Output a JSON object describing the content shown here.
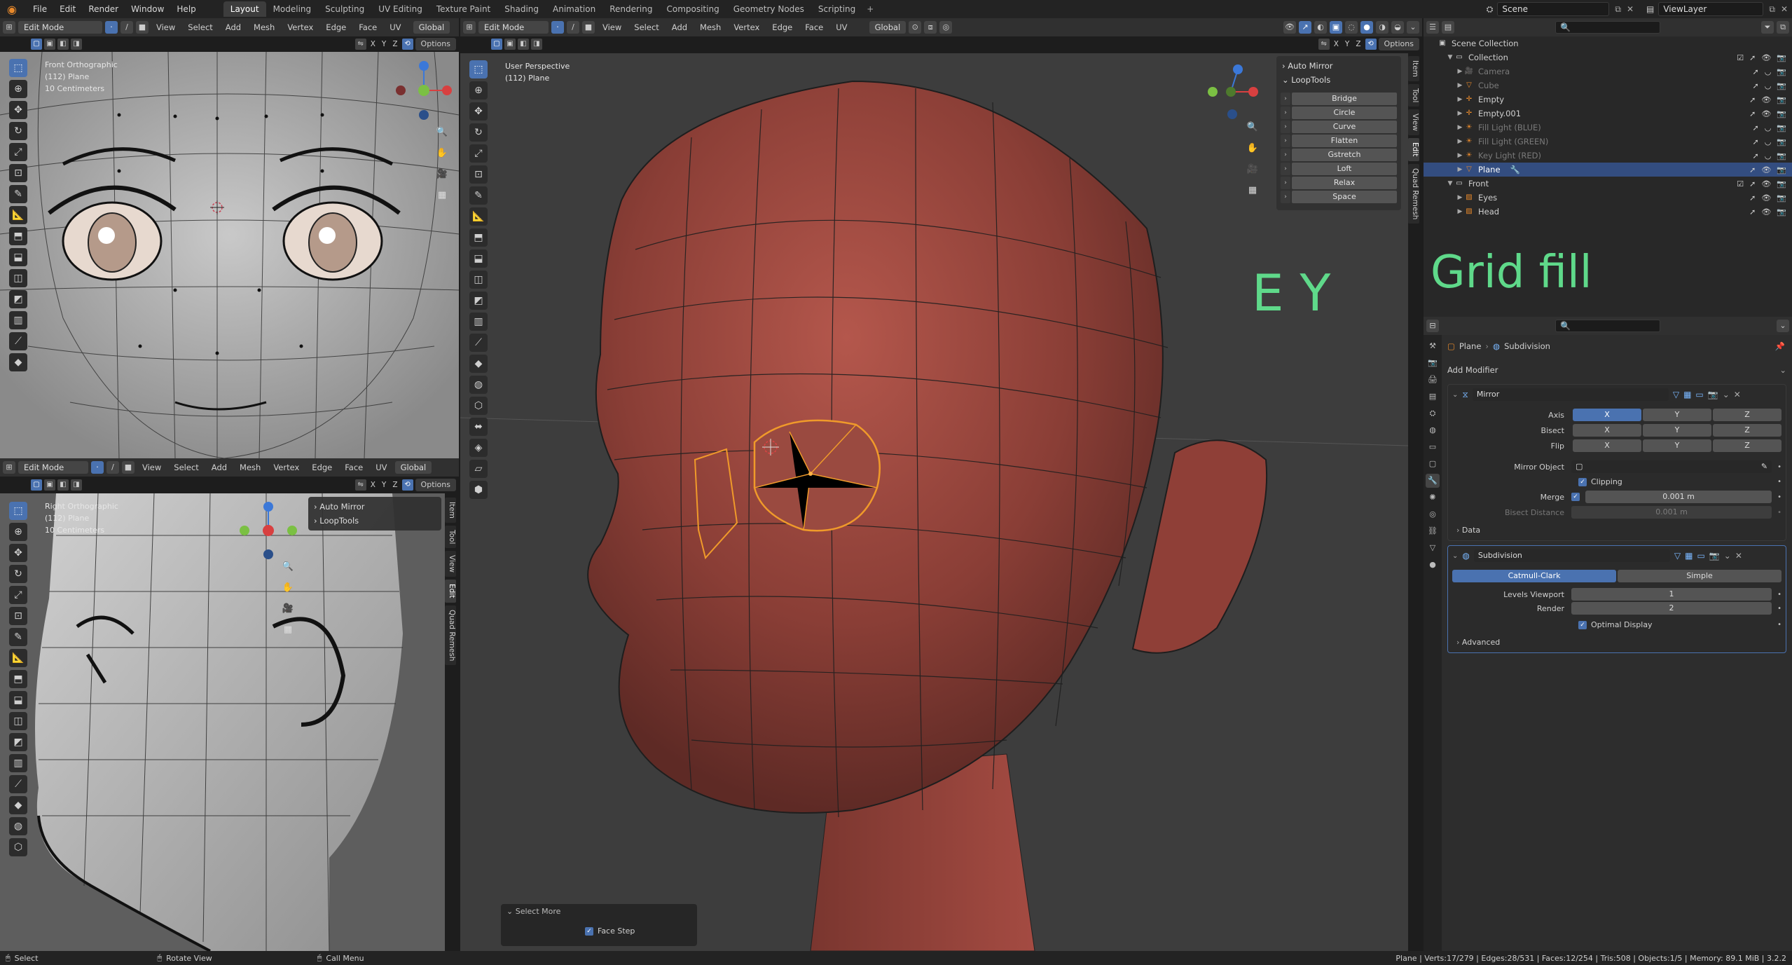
{
  "topbar": {
    "menus": [
      "File",
      "Edit",
      "Render",
      "Window",
      "Help"
    ],
    "workspaces": [
      "Layout",
      "Modeling",
      "Sculpting",
      "UV Editing",
      "Texture Paint",
      "Shading",
      "Animation",
      "Rendering",
      "Compositing",
      "Geometry Nodes",
      "Scripting"
    ],
    "active_workspace": "Layout",
    "scene": "Scene",
    "view_layer": "ViewLayer"
  },
  "viewport_header": {
    "mode": "Edit Mode",
    "menus": [
      "View",
      "Select",
      "Add",
      "Mesh",
      "Vertex",
      "Edge",
      "Face",
      "UV"
    ],
    "transform": "Global",
    "options": "Options",
    "axis_x": "X",
    "axis_y": "Y",
    "axis_z": "Z"
  },
  "front_view": {
    "line1": "Front Orthographic",
    "line2": "(112) Plane",
    "line3": "10 Centimeters"
  },
  "right_view": {
    "line1": "Right Orthographic",
    "line2": "(112) Plane",
    "line3": "10 Centimeters",
    "panel_auto_mirror": "Auto Mirror",
    "panel_looptools": "LoopTools"
  },
  "persp_view": {
    "line1": "User Perspective",
    "line2": "(112) Plane",
    "panel_auto_mirror": "Auto Mirror",
    "panel_looptools": "LoopTools",
    "looptools": [
      "Bridge",
      "Circle",
      "Curve",
      "Flatten",
      "Gstretch",
      "Loft",
      "Relax",
      "Space"
    ],
    "select_more_title": "Select More",
    "face_step": "Face Step",
    "annotation": "E Y"
  },
  "side_tabs": [
    "Item",
    "Tool",
    "View",
    "Edit",
    "Quad Remesh"
  ],
  "outliner": {
    "scene_collection": "Scene Collection",
    "collection": "Collection",
    "items": [
      "Camera",
      "Cube",
      "Empty",
      "Empty.001",
      "Fill Light (BLUE)",
      "Fill Light (GREEN)",
      "Key Light (RED)",
      "Plane"
    ],
    "front": "Front",
    "front_items": [
      "Eyes",
      "Head"
    ],
    "annotation": "Grid fill"
  },
  "properties": {
    "breadcrumb_object": "Plane",
    "breadcrumb_modifier": "Subdivision",
    "add_modifier": "Add Modifier",
    "mirror": {
      "name": "Mirror",
      "axis_label": "Axis",
      "bisect_label": "Bisect",
      "flip_label": "Flip",
      "x": "X",
      "y": "Y",
      "z": "Z",
      "mirror_object_label": "Mirror Object",
      "clipping": "Clipping",
      "merge_label": "Merge",
      "merge_value": "0.001 m",
      "bisect_distance_label": "Bisect Distance",
      "bisect_distance_value": "0.001 m",
      "data": "Data"
    },
    "subdivision": {
      "name": "Subdivision",
      "catmull": "Catmull-Clark",
      "simple": "Simple",
      "levels_viewport_label": "Levels Viewport",
      "levels_viewport": "1",
      "render_label": "Render",
      "render": "2",
      "optimal_display": "Optimal Display",
      "advanced": "Advanced"
    }
  },
  "statusbar": {
    "select": "Select",
    "rotate": "Rotate View",
    "call_menu": "Call Menu",
    "stats": "Plane | Verts:17/279 | Edges:28/531 | Faces:12/254 | Tris:508 | Objects:1/5 | Memory: 89.1 MiB | 3.2.2"
  }
}
